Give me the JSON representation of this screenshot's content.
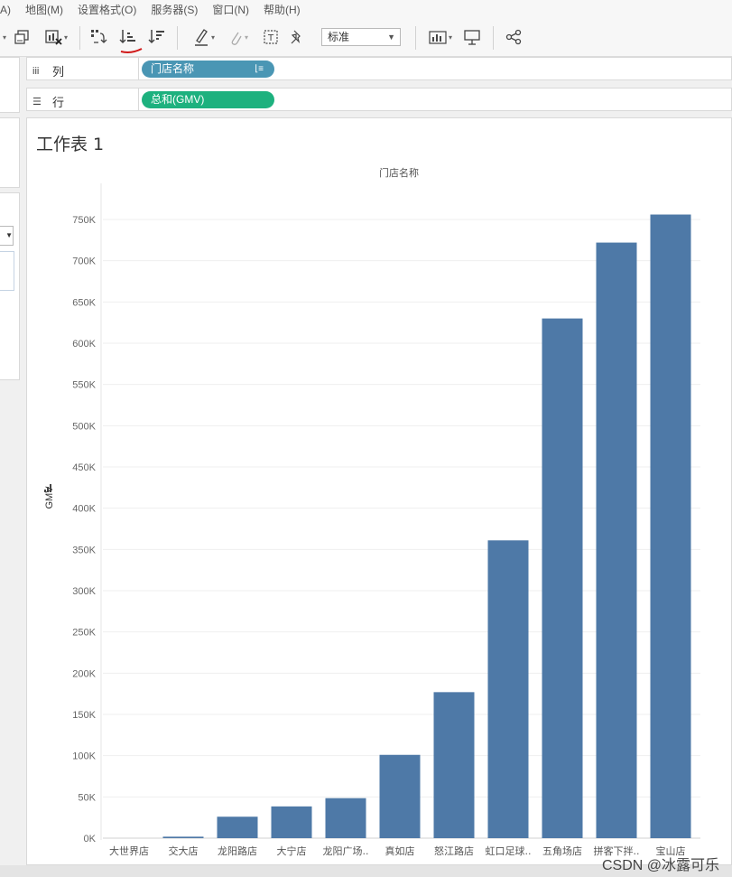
{
  "menu": [
    "A)",
    "地图(M)",
    "设置格式(O)",
    "服务器(S)",
    "窗口(N)",
    "帮助(H)"
  ],
  "toolbar": {
    "mark_size_select": "标准"
  },
  "shelves": {
    "columns": {
      "label": "列",
      "pill": "门店名称"
    },
    "rows": {
      "label": "行",
      "pill": "总和(GMV)"
    }
  },
  "sheet": {
    "title": "工作表 1"
  },
  "chart_data": {
    "type": "bar",
    "header": "门店名称",
    "ylabel": "GMV",
    "categories": [
      "大世界店",
      "交大店",
      "龙阳路店",
      "大宁店",
      "龙阳广场..",
      "真如店",
      "怒江路店",
      "虹口足球..",
      "五角场店",
      "拼客下拌..",
      "宝山店"
    ],
    "values": [
      0,
      1800,
      26000,
      38500,
      48500,
      101000,
      177000,
      361000,
      630000,
      722000,
      756000
    ],
    "ylim": [
      0,
      780000
    ],
    "yticks": [
      0,
      50000,
      100000,
      150000,
      200000,
      250000,
      300000,
      350000,
      400000,
      450000,
      500000,
      550000,
      600000,
      650000,
      700000,
      750000
    ],
    "ytick_labels": [
      "0K",
      "50K",
      "100K",
      "150K",
      "200K",
      "250K",
      "300K",
      "350K",
      "400K",
      "450K",
      "500K",
      "550K",
      "600K",
      "650K",
      "700K",
      "750K"
    ],
    "grid": true,
    "bar_color": "#4e79a7"
  },
  "watermark": "CSDN @冰露可乐"
}
